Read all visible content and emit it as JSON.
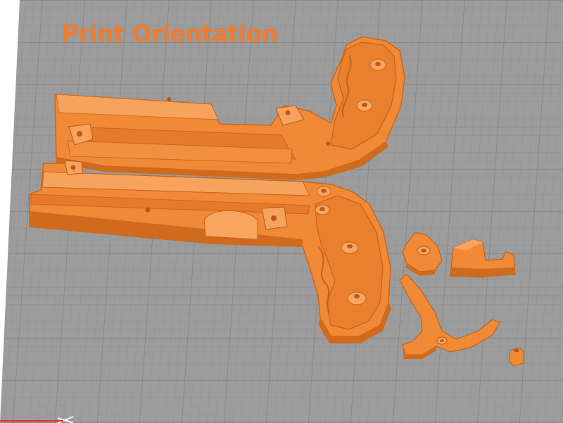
{
  "viewport": {
    "title": "Print Orientation",
    "colors": {
      "bed": "#9c9c9c",
      "grid_line": "#8a8a8a",
      "part": "#f08a36",
      "part_shadow": "#d06a1c",
      "part_highlight": "#f9a560",
      "title": "#ee7d32",
      "axis_x": "#e0302a",
      "axis_y": "#ffffff"
    },
    "icons": {
      "axis": "axis-triad-icon"
    }
  }
}
